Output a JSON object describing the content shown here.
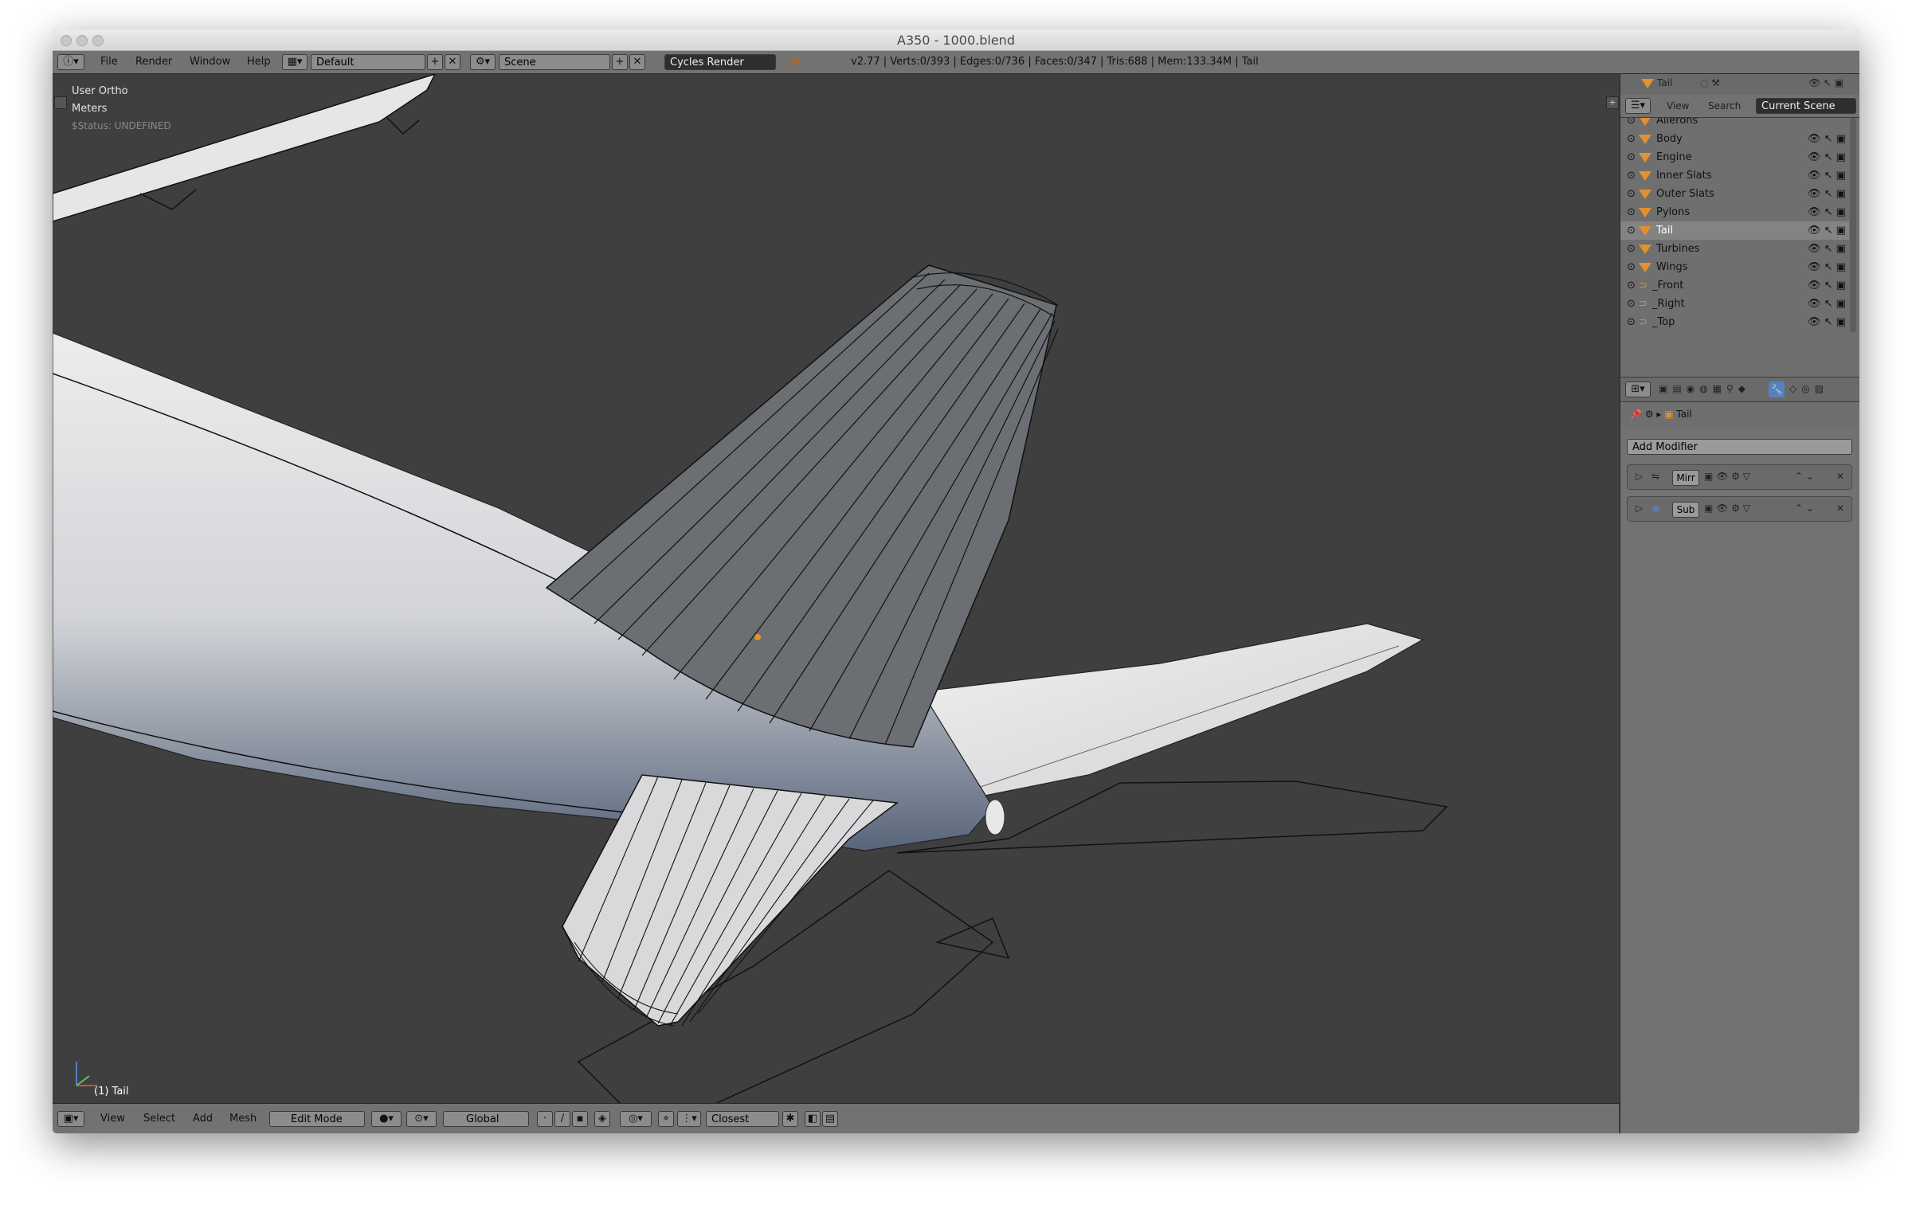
{
  "window": {
    "title": "A350 - 1000.blend"
  },
  "menu": {
    "items": [
      "File",
      "Render",
      "Window",
      "Help"
    ]
  },
  "topbar": {
    "layout": "Default",
    "scene": "Scene",
    "engine": "Cycles Render",
    "stats": "v2.77 | Verts:0/393 | Edges:0/736 | Faces:0/347 | Tris:688 | Mem:133.34M | Tail"
  },
  "viewport": {
    "view_name": "User Ortho",
    "units": "Meters",
    "status": "$Status: UNDEFINED",
    "object_label": "(1) Tail"
  },
  "bottombar": {
    "menus": [
      "View",
      "Select",
      "Add",
      "Mesh"
    ],
    "mode": "Edit Mode",
    "orientation": "Global",
    "snap": "Closest"
  },
  "outliner": {
    "active": "Tail",
    "tabs": [
      "View",
      "Search",
      "Current Scene"
    ],
    "items": [
      {
        "name": "Ailerons",
        "type": "mesh"
      },
      {
        "name": "Body",
        "type": "mesh"
      },
      {
        "name": "Engine",
        "type": "mesh"
      },
      {
        "name": "Inner Slats",
        "type": "mesh"
      },
      {
        "name": "Outer Slats",
        "type": "mesh"
      },
      {
        "name": "Pylons",
        "type": "mesh"
      },
      {
        "name": "Tail",
        "type": "mesh"
      },
      {
        "name": "Turbines",
        "type": "mesh"
      },
      {
        "name": "Wings",
        "type": "mesh"
      },
      {
        "name": "_Front",
        "type": "camera"
      },
      {
        "name": "_Right",
        "type": "camera"
      },
      {
        "name": "_Top",
        "type": "camera"
      }
    ]
  },
  "properties": {
    "context": "Tail",
    "add_modifier": "Add Modifier",
    "modifiers": [
      {
        "name": "Mirr"
      },
      {
        "name": "Sub"
      }
    ]
  },
  "colors": {
    "accent": "#5680c2",
    "object_orange": "#e3912e",
    "viewport_bg": "#3f3f3f"
  }
}
